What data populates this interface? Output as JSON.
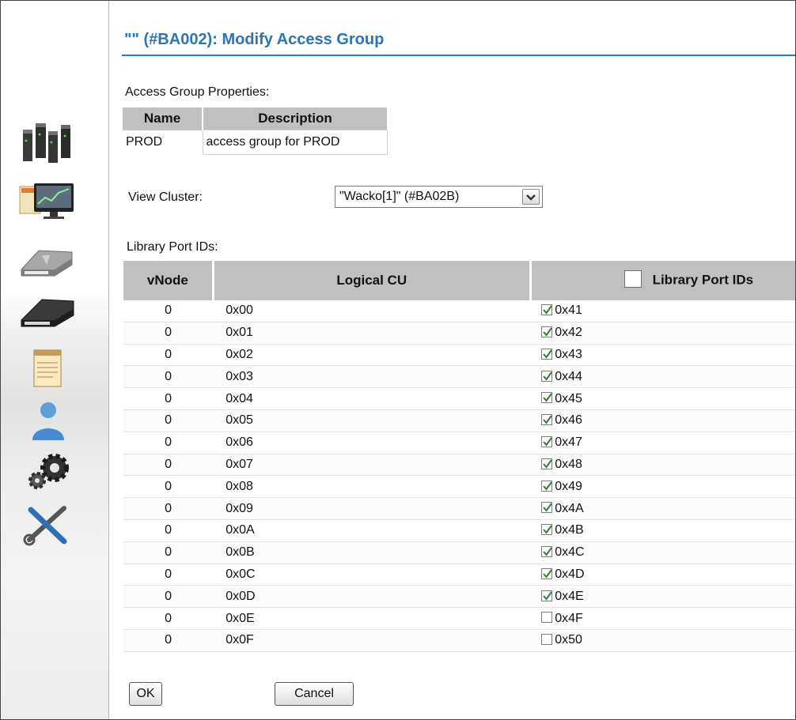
{
  "dialog": {
    "title": "\"\" (#BA002): Modify Access Group"
  },
  "properties": {
    "label": "Access Group Properties:",
    "headers": [
      "Name",
      "Description"
    ],
    "name": "PROD",
    "description": "access group for PROD"
  },
  "cluster": {
    "label": "View Cluster:",
    "selected": "\"Wacko[1]\" (#BA02B)"
  },
  "ports": {
    "label": "Library Port IDs:",
    "headers": {
      "vnode": "vNode",
      "logical_cu": "Logical CU",
      "port_ids": "Library Port IDs"
    },
    "select_all_checked": false,
    "rows": [
      {
        "vnode": "0",
        "cu": "0x00",
        "port": "0x41",
        "checked": true
      },
      {
        "vnode": "0",
        "cu": "0x01",
        "port": "0x42",
        "checked": true
      },
      {
        "vnode": "0",
        "cu": "0x02",
        "port": "0x43",
        "checked": true
      },
      {
        "vnode": "0",
        "cu": "0x03",
        "port": "0x44",
        "checked": true
      },
      {
        "vnode": "0",
        "cu": "0x04",
        "port": "0x45",
        "checked": true
      },
      {
        "vnode": "0",
        "cu": "0x05",
        "port": "0x46",
        "checked": true
      },
      {
        "vnode": "0",
        "cu": "0x06",
        "port": "0x47",
        "checked": true
      },
      {
        "vnode": "0",
        "cu": "0x07",
        "port": "0x48",
        "checked": true
      },
      {
        "vnode": "0",
        "cu": "0x08",
        "port": "0x49",
        "checked": true
      },
      {
        "vnode": "0",
        "cu": "0x09",
        "port": "0x4A",
        "checked": true
      },
      {
        "vnode": "0",
        "cu": "0x0A",
        "port": "0x4B",
        "checked": true
      },
      {
        "vnode": "0",
        "cu": "0x0B",
        "port": "0x4C",
        "checked": true
      },
      {
        "vnode": "0",
        "cu": "0x0C",
        "port": "0x4D",
        "checked": true
      },
      {
        "vnode": "0",
        "cu": "0x0D",
        "port": "0x4E",
        "checked": true
      },
      {
        "vnode": "0",
        "cu": "0x0E",
        "port": "0x4F",
        "checked": false
      },
      {
        "vnode": "0",
        "cu": "0x0F",
        "port": "0x50",
        "checked": false
      }
    ]
  },
  "buttons": {
    "ok": "OK",
    "cancel": "Cancel"
  },
  "sidebar": {
    "icons": [
      "servers-icon",
      "monitor-chart-icon",
      "virtual-drive-icon",
      "physical-library-icon",
      "notepad-icon",
      "user-icon",
      "gears-icon",
      "tools-icon"
    ]
  },
  "colors": {
    "accent": "#2a74b8",
    "header_bg": "#c0c0c0"
  }
}
